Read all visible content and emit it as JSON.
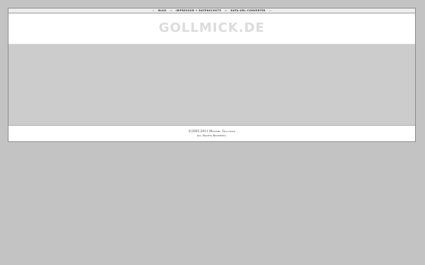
{
  "nav": {
    "left_cap": [
      "...",
      "..."
    ],
    "items": [
      "BLOG",
      "IMPRESSUM + DATENSCHUTZ",
      "DATA-URL-CONVERTER"
    ],
    "separator": "::",
    "right_cap": [
      "...",
      "..."
    ]
  },
  "header": {
    "logo": "GOLLMICK.DE"
  },
  "footer": {
    "copyright": "©2005-2011 Michael Gollmick",
    "rights": "All Rights Reserved."
  },
  "colors": {
    "page_background": "#c3c3c3",
    "content_background": "#cccccc",
    "logo": "#dcdcdc"
  }
}
